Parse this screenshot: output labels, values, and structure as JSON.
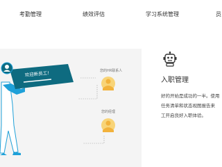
{
  "nav": {
    "items": [
      {
        "label": "考勤管理"
      },
      {
        "label": "绩效评估"
      },
      {
        "label": "学习系统管理"
      },
      {
        "label": "员"
      }
    ]
  },
  "illustration": {
    "banner_text": "欢迎新员工!",
    "hr_label": "您的HR联系人",
    "manager_label": "您的经理"
  },
  "info": {
    "icon": "robot-icon",
    "title": "入职管理",
    "description_lines": [
      "好的开始是成功的一半。使用",
      "任务清单和状态视图报告来",
      "工开启良好入职体验。"
    ]
  },
  "colors": {
    "banner": "#0e6b80",
    "avatar_circle": "#f8d478",
    "avatar_face": "#f2b23c",
    "person_accent": "#1ea0d8",
    "panel_bg": "#f4f4f4",
    "text": "#333333"
  }
}
